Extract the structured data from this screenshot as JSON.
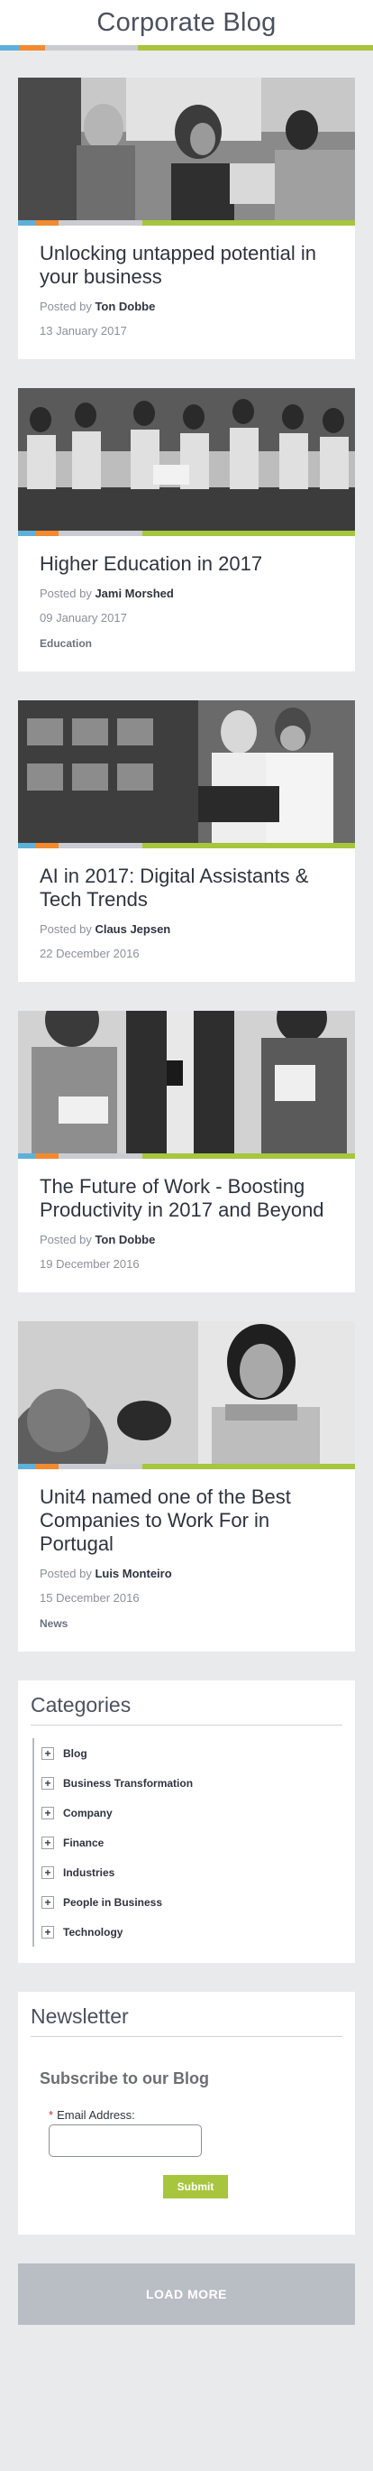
{
  "header": {
    "title": "Corporate Blog"
  },
  "colors": {
    "stripe_blue": "#5fb0d9",
    "stripe_orange": "#f28a30",
    "stripe_grey": "#c9ccd1",
    "stripe_green": "#a7c53d",
    "submit_green": "#a7c53d",
    "load_more_bg": "#b9bdc4"
  },
  "posts": [
    {
      "title": "Unlocking untapped potential in your business",
      "posted_by_prefix": "Posted by ",
      "author": "Ton Dobbe",
      "date": "13 January 2017",
      "tag": "",
      "image": "group-meeting-photo"
    },
    {
      "title": "Higher Education in 2017",
      "posted_by_prefix": "Posted by ",
      "author": "Jami Morshed",
      "date": "09 January 2017",
      "tag": "Education",
      "image": "students-on-bench-photo"
    },
    {
      "title": "AI in 2017: Digital Assistants & Tech Trends",
      "posted_by_prefix": "Posted by ",
      "author": "Claus Jepsen",
      "date": "22 December 2016",
      "tag": "",
      "image": "couple-with-laptop-photo"
    },
    {
      "title": "The Future of Work - Boosting Productivity in 2017 and Beyond",
      "posted_by_prefix": "Posted by ",
      "author": "Ton Dobbe",
      "date": "19 December 2016",
      "tag": "",
      "image": "people-with-devices-photo"
    },
    {
      "title": "Unit4 named one of the Best Companies to Work For in Portugal",
      "posted_by_prefix": "Posted by ",
      "author": "Luis Monteiro",
      "date": "15 December 2016",
      "tag": "News",
      "image": "smiling-woman-photo"
    }
  ],
  "categories": {
    "title": "Categories",
    "items": [
      {
        "label": "Blog"
      },
      {
        "label": "Business Transformation"
      },
      {
        "label": "Company"
      },
      {
        "label": "Finance"
      },
      {
        "label": "Industries"
      },
      {
        "label": "People in Business"
      },
      {
        "label": "Technology"
      }
    ]
  },
  "newsletter": {
    "title": "Newsletter",
    "heading": "Subscribe to our Blog",
    "required_marker": "*",
    "email_label": "Email Address:",
    "email_value": "",
    "submit_label": "Submit"
  },
  "load_more": {
    "label": "LOAD MORE"
  }
}
